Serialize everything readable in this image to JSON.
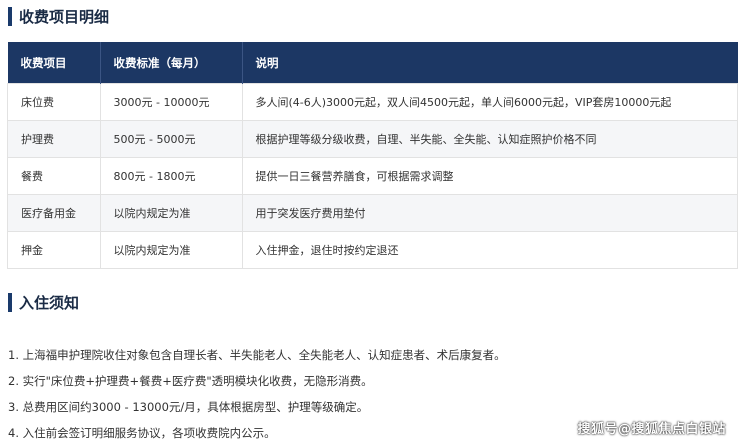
{
  "section1": {
    "title": "收费项目明细"
  },
  "table": {
    "headers": [
      "收费项目",
      "收费标准（每月）",
      "说明"
    ],
    "rows": [
      [
        "床位费",
        "3000元 - 10000元",
        "多人间(4-6人)3000元起，双人间4500元起，单人间6000元起，VIP套房10000元起"
      ],
      [
        "护理费",
        "500元 - 5000元",
        "根据护理等级分级收费，自理、半失能、全失能、认知症照护价格不同"
      ],
      [
        "餐费",
        "800元 - 1800元",
        "提供一日三餐营养膳食，可根据需求调整"
      ],
      [
        "医疗备用金",
        "以院内规定为准",
        "用于突发医疗费用垫付"
      ],
      [
        "押金",
        "以院内规定为准",
        "入住押金，退住时按约定退还"
      ]
    ]
  },
  "section2": {
    "title": "入住须知"
  },
  "notes": [
    "1. 上海福申护理院收住对象包含自理长者、半失能老人、全失能老人、认知症患者、术后康复者。",
    "2. 实行\"床位费+护理费+餐费+医疗费\"透明模块化收费，无隐形消费。",
    "3. 总费用区间约3000 - 13000元/月，具体根据房型、护理等级确定。",
    "4. 入住前会签订明细服务协议，各项收费院内公示。"
  ],
  "watermark": "搜狐号@搜狐焦点白银站",
  "colors": {
    "header_bg": "#1c3764",
    "accent_bar": "#1a3a6b",
    "alt_row_bg": "#f5f6f8"
  }
}
